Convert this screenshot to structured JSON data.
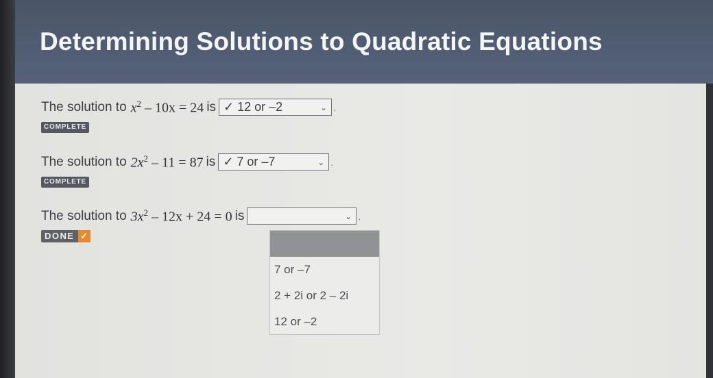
{
  "header": {
    "title": "Determining Solutions to Quadratic Equations"
  },
  "questions": [
    {
      "prefix": "The solution to",
      "equation_lhs_a": "x",
      "equation_exp": "2",
      "equation_rest": " – 10x = 24",
      "suffix": "is",
      "selected_value": "✓ 12 or –2",
      "badge": "COMPLETE"
    },
    {
      "prefix": "The solution to",
      "equation_lhs_a": "2x",
      "equation_exp": "2",
      "equation_rest": " – 11 = 87",
      "suffix": "is",
      "selected_value": "✓ 7 or –7",
      "badge": "COMPLETE"
    },
    {
      "prefix": "The solution to",
      "equation_lhs_a": "3x",
      "equation_exp": "2",
      "equation_rest": " – 12x + 24 = 0",
      "suffix": "is",
      "selected_value": "",
      "badge": "DONE"
    }
  ],
  "dropdown": {
    "options": [
      "7 or –7",
      "2 + 2i or 2 – 2i",
      "12 or –2"
    ]
  },
  "icons": {
    "chevron": "chevron-down-icon",
    "done_check": "check-icon"
  },
  "colors": {
    "header_bg": "#4f5a6e",
    "done_check_bg": "#e58b2c"
  }
}
